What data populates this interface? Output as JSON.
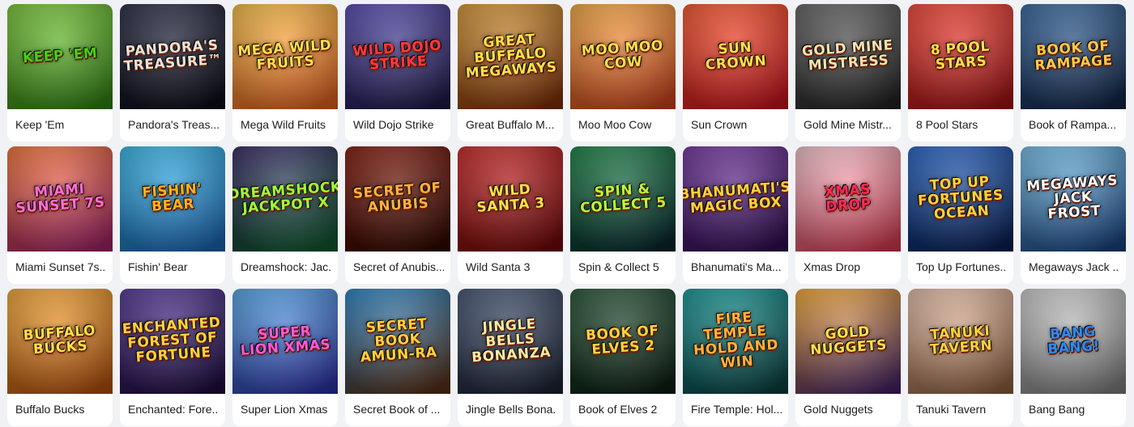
{
  "games": [
    {
      "title": "Keep 'Em",
      "logo": "KEEP 'EM",
      "c1": "#7fd23a",
      "c2": "#2e7d12",
      "fg": "#46d10f"
    },
    {
      "title": "Pandora's Treas...",
      "logo": "PANDORA'S TREASURE™",
      "c1": "#2b2f4a",
      "c2": "#0a0b14",
      "fg": "#e9e4d8"
    },
    {
      "title": "Mega Wild Fruits",
      "logo": "MEGA WILD FRUITS",
      "c1": "#ffc94a",
      "c2": "#e0581d",
      "fg": "#ffe14a"
    },
    {
      "title": "Wild Dojo Strike",
      "logo": "WILD DOJO STRIKE",
      "c1": "#5a4fb8",
      "c2": "#1a1540",
      "fg": "#ff3a3a"
    },
    {
      "title": "Great Buffalo M...",
      "logo": "GREAT BUFFALO MEGAWAYS",
      "c1": "#e0a23a",
      "c2": "#7a2a05",
      "fg": "#ffe14a"
    },
    {
      "title": "Moo Moo Cow",
      "logo": "MOO MOO COW",
      "c1": "#ffb347",
      "c2": "#c93b1a",
      "fg": "#ffe14a"
    },
    {
      "title": "Sun Crown",
      "logo": "SUN CROWN",
      "c1": "#ff5b2e",
      "c2": "#c40f1c",
      "fg": "#ffe14a"
    },
    {
      "title": "Gold Mine Mistr...",
      "logo": "GOLD MINE MISTRESS",
      "c1": "#6a6a6a",
      "c2": "#1e1e1e",
      "fg": "#f3e2b0"
    },
    {
      "title": "8 Pool Stars",
      "logo": "8 POOL STARS",
      "c1": "#ff4b3a",
      "c2": "#9c0e12",
      "fg": "#ffe14a"
    },
    {
      "title": "Book of Rampa...",
      "logo": "BOOK OF RAMPAGE",
      "c1": "#3a6fa8",
      "c2": "#0f2040",
      "fg": "#ffc94a"
    },
    {
      "title": "Miami Sunset 7s...",
      "logo": "MIAMI SUNSET 7s",
      "c1": "#ff7a3a",
      "c2": "#9c1e6a",
      "fg": "#ff6ed8"
    },
    {
      "title": "Fishin' Bear",
      "logo": "FISHIN' BEAR",
      "c1": "#3ac0f0",
      "c2": "#1760b0",
      "fg": "#ffb21a"
    },
    {
      "title": "Dreamshock: Jac...",
      "logo": "DREAMSHOCK JACKPOT X",
      "c1": "#3a2a6a",
      "c2": "#0c5a2a",
      "fg": "#9cff3a"
    },
    {
      "title": "Secret of Anubis...",
      "logo": "SECRET OF ANUBIS",
      "c1": "#8a1e0e",
      "c2": "#2a0600",
      "fg": "#ffb23a"
    },
    {
      "title": "Wild Santa 3",
      "logo": "WILD SANTA 3",
      "c1": "#d42a2a",
      "c2": "#6a0606",
      "fg": "#ffe14a"
    },
    {
      "title": "Spin & Collect 5",
      "logo": "SPIN & COLLECT 5",
      "c1": "#1e8a4a",
      "c2": "#04202a",
      "fg": "#b6ff3a"
    },
    {
      "title": "Bhanumati's Ma...",
      "logo": "BHANUMATI'S MAGIC BOX",
      "c1": "#7a3aa8",
      "c2": "#2a0a4a",
      "fg": "#ffd23a"
    },
    {
      "title": "Xmas Drop",
      "logo": "XMAS DROP",
      "c1": "#ffd0d8",
      "c2": "#d2304a",
      "fg": "#ff2a5a"
    },
    {
      "title": "Top Up Fortunes...",
      "logo": "TOP UP FORTUNES OCEAN",
      "c1": "#2a6ad0",
      "c2": "#061a4a",
      "fg": "#ffd23a"
    },
    {
      "title": "Megaways Jack ...",
      "logo": "MEGAWAYS JACK FROST",
      "c1": "#7ac8f0",
      "c2": "#123a7a",
      "fg": "#ffffff"
    },
    {
      "title": "Buffalo Bucks",
      "logo": "BUFFALO BUCKS",
      "c1": "#ffb23a",
      "c2": "#b04a0a",
      "fg": "#ffe14a"
    },
    {
      "title": "Enchanted: Fore...",
      "logo": "ENCHANTED FOREST OF FORTUNE",
      "c1": "#5a3aa0",
      "c2": "#1a0a3a",
      "fg": "#ffd23a"
    },
    {
      "title": "Super Lion Xmas",
      "logo": "SUPER LION XMAS",
      "c1": "#5ab0f0",
      "c2": "#2a2aa0",
      "fg": "#ff5ad8"
    },
    {
      "title": "Secret Book of ...",
      "logo": "SECRET BOOK AMUN-RA",
      "c1": "#2a8ad0",
      "c2": "#5a2a0a",
      "fg": "#ffd23a"
    },
    {
      "title": "Jingle Bells Bona...",
      "logo": "JINGLE BELLS BONANZA",
      "c1": "#4a5a7a",
      "c2": "#1a2030",
      "fg": "#ffe9a0"
    },
    {
      "title": "Book of Elves 2",
      "logo": "BOOK OF ELVES 2",
      "c1": "#2a5a3a",
      "c2": "#0a1a10",
      "fg": "#ffd23a"
    },
    {
      "title": "Fire Temple: Hol...",
      "logo": "FIRE TEMPLE HOLD AND WIN",
      "c1": "#1aa0a0",
      "c2": "#0a3a3a",
      "fg": "#ffb23a"
    },
    {
      "title": "Gold Nuggets",
      "logo": "GOLD NUGGETS",
      "c1": "#ffb23a",
      "c2": "#3a1a6a",
      "fg": "#ffe14a"
    },
    {
      "title": "Tanuki Tavern",
      "logo": "TANUKI TAVERN",
      "c1": "#f0c8b0",
      "c2": "#8a5a3a",
      "fg": "#ffd23a"
    },
    {
      "title": "Bang Bang",
      "logo": "BANG BANG!",
      "c1": "#d8d8d8",
      "c2": "#7a7a7a",
      "fg": "#2a8aff"
    }
  ]
}
